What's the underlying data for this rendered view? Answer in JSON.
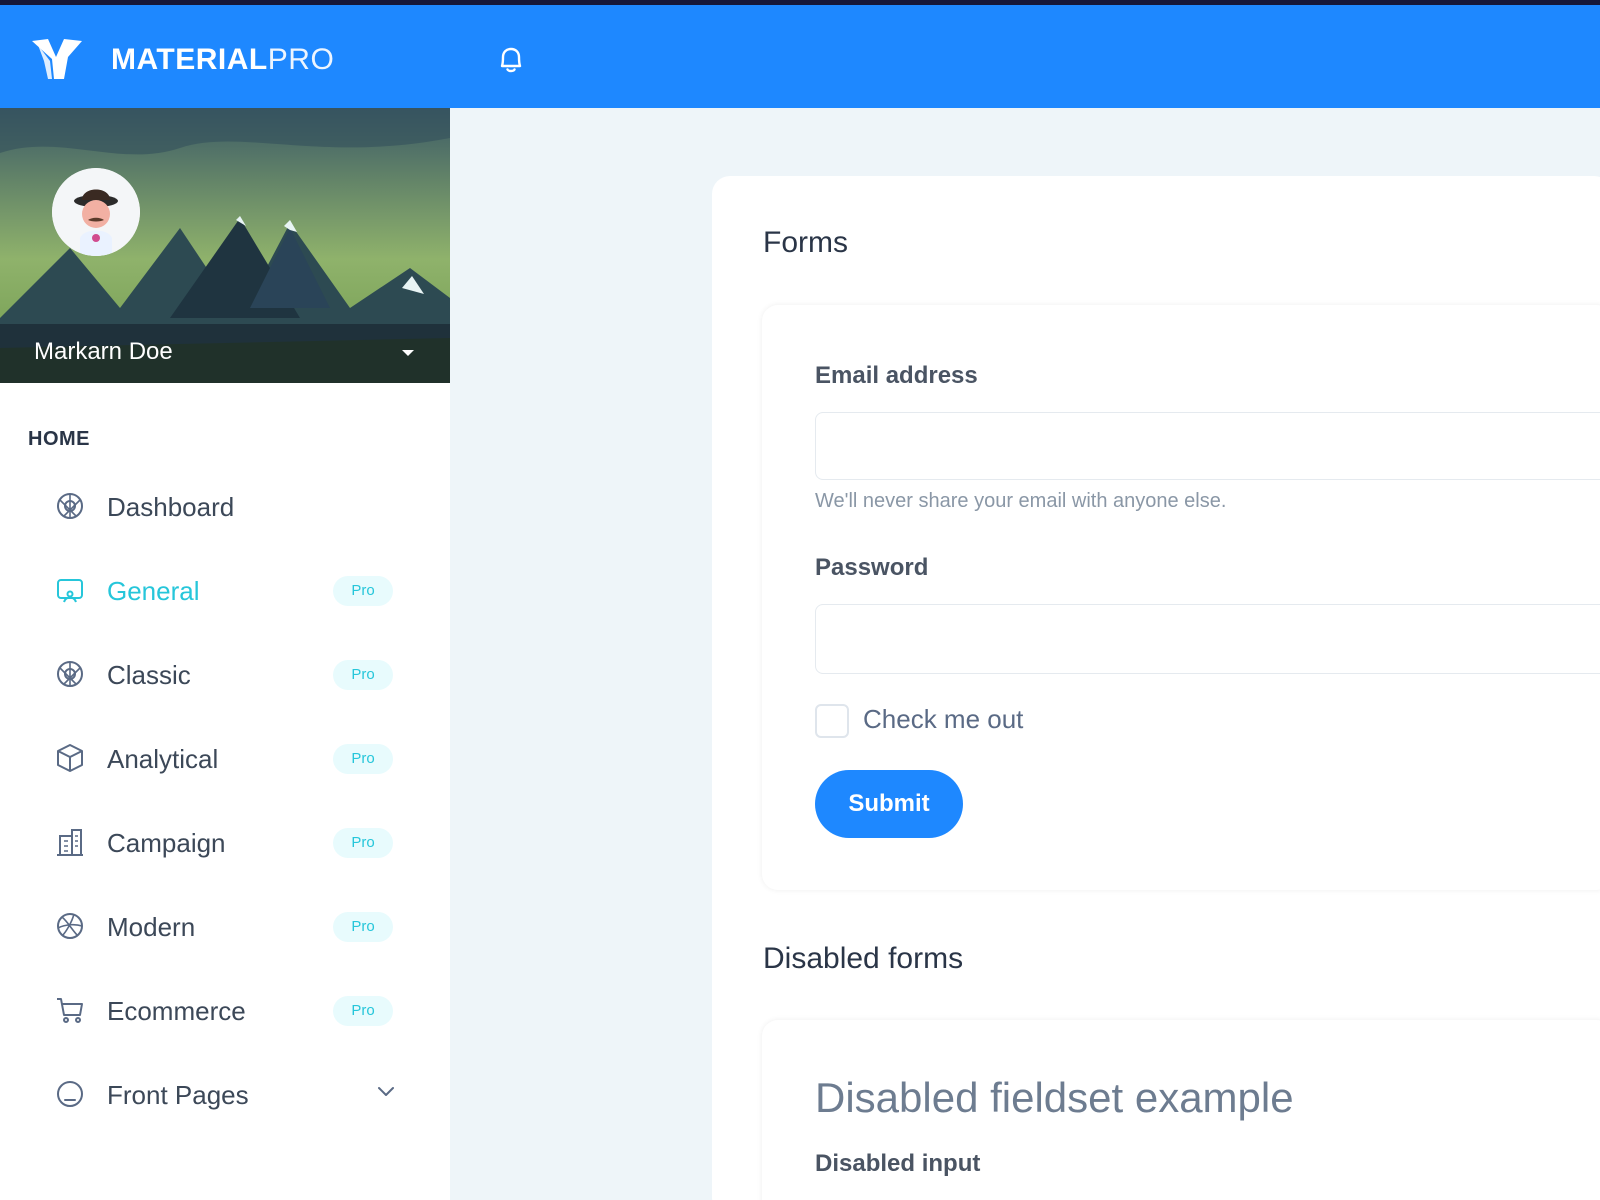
{
  "app": {
    "brand_bold": "MATERIAL",
    "brand_light": "PRO"
  },
  "profile": {
    "name": "Markarn Doe"
  },
  "sidebar": {
    "header": "HOME",
    "items": [
      {
        "label": "Dashboard",
        "icon": "aperture-icon",
        "badge": ""
      },
      {
        "label": "General",
        "icon": "screen-share-icon",
        "badge": "Pro",
        "active": true
      },
      {
        "label": "Classic",
        "icon": "aperture-icon",
        "badge": "Pro"
      },
      {
        "label": "Analytical",
        "icon": "box-icon",
        "badge": "Pro"
      },
      {
        "label": "Campaign",
        "icon": "building-icon",
        "badge": "Pro"
      },
      {
        "label": "Modern",
        "icon": "ball-icon",
        "badge": "Pro"
      },
      {
        "label": "Ecommerce",
        "icon": "cart-icon",
        "badge": "Pro"
      },
      {
        "label": "Front Pages",
        "icon": "app-window-icon",
        "badge": ""
      }
    ]
  },
  "forms": {
    "title": "Forms",
    "email_label": "Email address",
    "email_value": "",
    "email_help": "We'll never share your email with anyone else.",
    "password_label": "Password",
    "password_value": "",
    "check_label": "Check me out",
    "submit_label": "Submit"
  },
  "disabled_forms": {
    "title": "Disabled forms",
    "legend": "Disabled fieldset example",
    "input_label": "Disabled input"
  },
  "colors": {
    "primary": "#1e88ff",
    "accent": "#26c6da",
    "background": "#eef5f9"
  }
}
